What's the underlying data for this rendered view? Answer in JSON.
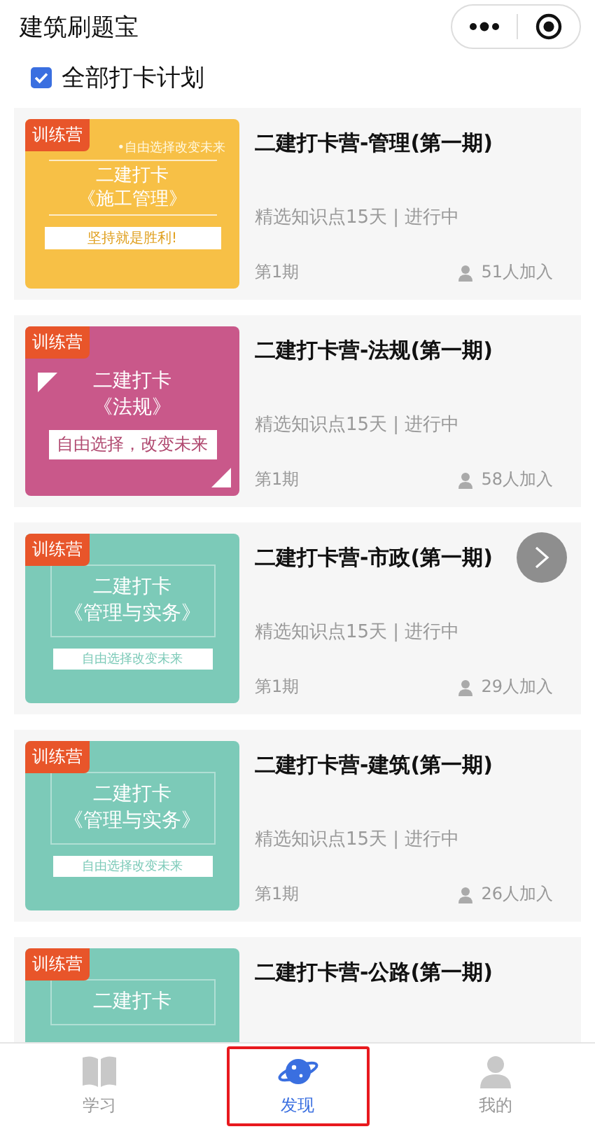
{
  "header": {
    "title": "建筑刷题宝"
  },
  "section": {
    "label": "全部打卡计划",
    "checked": true
  },
  "cards": [
    {
      "badge": "训练营",
      "title": "二建打卡营-管理(第一期)",
      "subtitle": "精选知识点15天 | 进行中",
      "period": "第1期",
      "joined": "51人加入",
      "cover": {
        "kind": "banner",
        "color": "#f7c046",
        "tagline": "•自由选择改变未来",
        "lines": [
          "二建打卡",
          "《施工管理》"
        ],
        "slogan": "坚持就是胜利!"
      }
    },
    {
      "badge": "训练营",
      "title": "二建打卡营-法规(第一期)",
      "subtitle": "精选知识点15天 | 进行中",
      "period": "第1期",
      "joined": "58人加入",
      "cover": {
        "kind": "corners",
        "color": "#c9588a",
        "lines": [
          "二建打卡",
          "《法规》"
        ],
        "slogan": "自由选择，改变未来"
      }
    },
    {
      "badge": "训练营",
      "title": "二建打卡营-市政(第一期)",
      "subtitle": "精选知识点15天 | 进行中",
      "period": "第1期",
      "joined": "29人加入",
      "cover": {
        "kind": "frame",
        "color": "#7ccab8",
        "lines": [
          "二建打卡",
          "《管理与实务》"
        ],
        "slogan": "自由选择改变未来"
      }
    },
    {
      "badge": "训练营",
      "title": "二建打卡营-建筑(第一期)",
      "subtitle": "精选知识点15天 | 进行中",
      "period": "第1期",
      "joined": "26人加入",
      "cover": {
        "kind": "frame",
        "color": "#7ccab8",
        "lines": [
          "二建打卡",
          "《管理与实务》"
        ],
        "slogan": "自由选择改变未来"
      }
    },
    {
      "badge": "训练营",
      "title": "二建打卡营-公路(第一期)",
      "cover": {
        "kind": "frame",
        "color": "#7ccab8",
        "lines": [
          "二建打卡"
        ]
      }
    }
  ],
  "tabs": [
    {
      "label": "学习",
      "kind": "book",
      "selected": false,
      "highlighted": false
    },
    {
      "label": "发现",
      "kind": "planet",
      "selected": true,
      "highlighted": true
    },
    {
      "label": "我的",
      "kind": "person",
      "selected": false,
      "highlighted": false
    }
  ]
}
